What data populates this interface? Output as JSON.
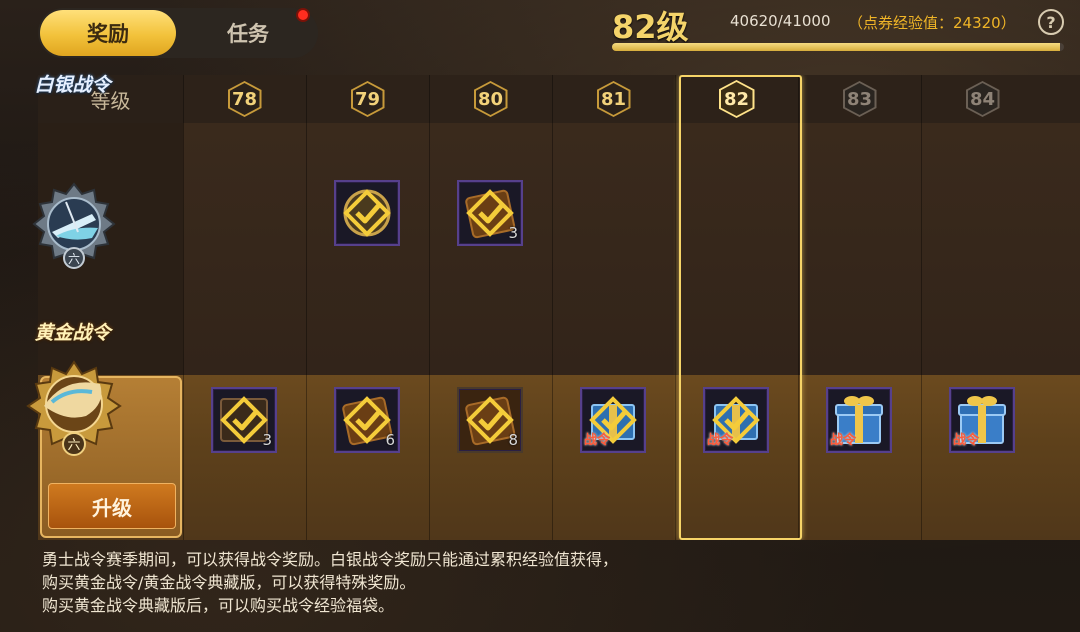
{
  "header": {
    "tabs": [
      {
        "label": "奖励",
        "active": true
      },
      {
        "label": "任务",
        "active": false,
        "notification": true
      }
    ],
    "level_title": "82级",
    "xp_text": "40620/41000",
    "xp_extra": "（点券经验值：24320）",
    "xp_progress": 0.9907,
    "help_icon": "question-icon"
  },
  "grid": {
    "level_header_label": "等级",
    "levels": [
      "78",
      "79",
      "80",
      "81",
      "82",
      "83",
      "84"
    ],
    "current_level": "82",
    "silver_pass": {
      "name": "白银战令",
      "rank": "六",
      "rewards": [
        null,
        {
          "icon": "check-emblem-icon",
          "qty": ""
        },
        {
          "icon": "check-scroll-icon",
          "qty": "3"
        },
        null,
        null,
        null,
        null
      ]
    },
    "gold_pass": {
      "name": "黄金战令",
      "rank": "六",
      "upgrade_label": "升级",
      "rewards": [
        {
          "icon": "check-box-icon",
          "qty": "3"
        },
        {
          "icon": "check-scroll-icon",
          "qty": "6"
        },
        {
          "icon": "check-scroll-icon",
          "qty": "8"
        },
        {
          "icon": "check-gift-icon",
          "tag": "战令"
        },
        {
          "icon": "check-gift-icon",
          "tag": "战令"
        },
        {
          "icon": "gift-box-icon",
          "tag": "战令"
        },
        {
          "icon": "gift-box-icon",
          "tag": "战令"
        }
      ]
    }
  },
  "footer": {
    "lines": [
      "勇士战令赛季期间，可以获得战令奖励。白银战令奖励只能通过累积经验值获得，",
      "购买黄金战令/黄金战令典藏版，可以获得特殊奖励。",
      "购买黄金战令典藏版后，可以购买战令经验福袋。"
    ]
  },
  "colors": {
    "accent_gold": "#f2c23b",
    "xp_extra": "#f0b527",
    "notification": "#ff2d1f",
    "slot_border": "#56408c"
  }
}
